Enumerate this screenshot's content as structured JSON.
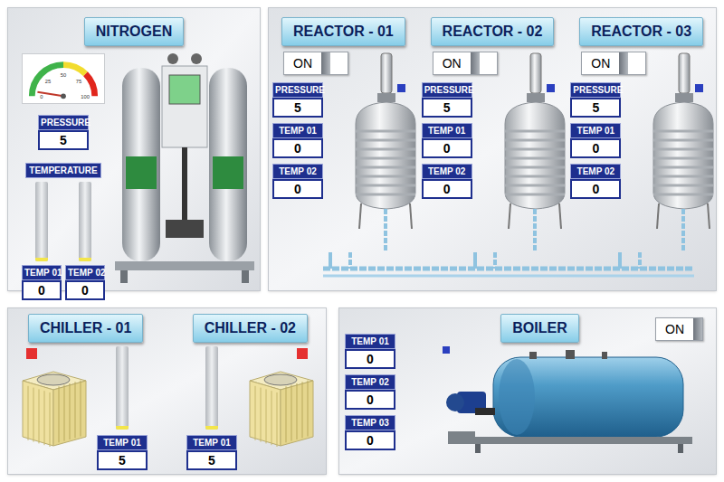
{
  "nitrogen": {
    "title": "NITROGEN",
    "gauge": {
      "ticks": [
        "0",
        "25",
        "50",
        "75",
        "100"
      ],
      "level": 0.05
    },
    "pressure": {
      "label": "PRESSURE",
      "value": "5"
    },
    "temperature": {
      "label": "TEMPERATURE",
      "bars": [
        {
          "label": "TEMP 01",
          "value": "0",
          "level": 0.04
        },
        {
          "label": "TEMP 02",
          "value": "0",
          "level": 0.04
        }
      ]
    }
  },
  "reactors": [
    {
      "title": "REACTOR - 01",
      "switch": "ON",
      "on": true,
      "alarm": false,
      "readings": [
        {
          "label": "PRESSURE",
          "value": "5"
        },
        {
          "label": "TEMP 01",
          "value": "0"
        },
        {
          "label": "TEMP 02",
          "value": "0"
        }
      ]
    },
    {
      "title": "REACTOR - 02",
      "switch": "ON",
      "on": true,
      "alarm": false,
      "readings": [
        {
          "label": "PRESSURE",
          "value": "5"
        },
        {
          "label": "TEMP 01",
          "value": "0"
        },
        {
          "label": "TEMP 02",
          "value": "0"
        }
      ]
    },
    {
      "title": "REACTOR - 03",
      "switch": "ON",
      "on": true,
      "alarm": false,
      "readings": [
        {
          "label": "PRESSURE",
          "value": "5"
        },
        {
          "label": "TEMP 01",
          "value": "0"
        },
        {
          "label": "TEMP 02",
          "value": "0"
        }
      ]
    }
  ],
  "chillers": [
    {
      "title": "CHILLER - 01",
      "alarm": true,
      "level": 0.04,
      "reading": {
        "label": "TEMP 01",
        "value": "5"
      }
    },
    {
      "title": "CHILLER - 02",
      "alarm": true,
      "level": 0.04,
      "reading": {
        "label": "TEMP 01",
        "value": "5"
      }
    }
  ],
  "boiler": {
    "title": "BOILER",
    "switch": "ON",
    "on": true,
    "alarm": false,
    "readings": [
      {
        "label": "TEMP 01",
        "value": "0"
      },
      {
        "label": "TEMP 02",
        "value": "0"
      },
      {
        "label": "TEMP 03",
        "value": "0"
      }
    ]
  }
}
